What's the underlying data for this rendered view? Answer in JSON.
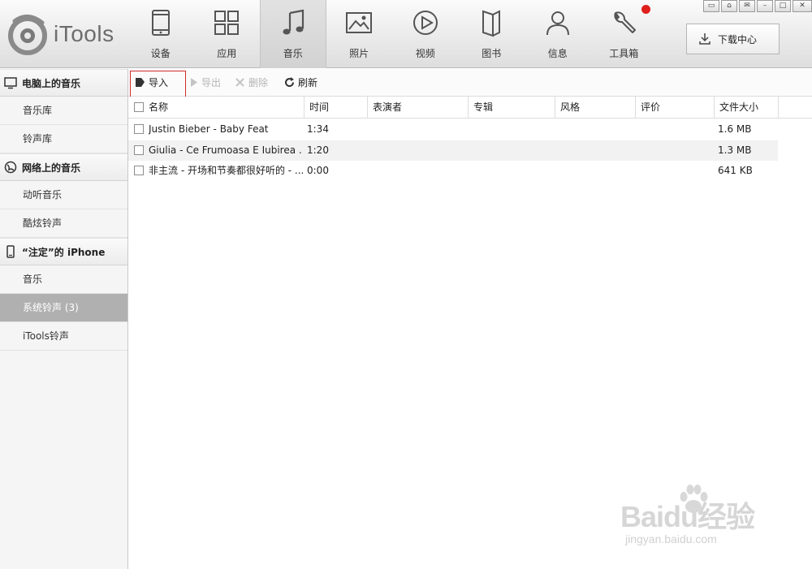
{
  "app": {
    "title": "iTools"
  },
  "nav": [
    {
      "label": "设备",
      "icon": "device-icon"
    },
    {
      "label": "应用",
      "icon": "apps-icon"
    },
    {
      "label": "音乐",
      "icon": "music-icon",
      "active": true
    },
    {
      "label": "照片",
      "icon": "photo-icon"
    },
    {
      "label": "视频",
      "icon": "video-icon"
    },
    {
      "label": "图书",
      "icon": "book-icon"
    },
    {
      "label": "信息",
      "icon": "user-icon"
    },
    {
      "label": "工具箱",
      "icon": "wrench-icon",
      "badge": true
    }
  ],
  "window_controls": [
    "feedback-icon",
    "skin-icon",
    "mail-icon",
    "minimize-icon",
    "maximize-icon",
    "close-icon"
  ],
  "download_center": {
    "label": "下载中心"
  },
  "sidebar": {
    "sections": [
      {
        "title": "电脑上的音乐",
        "icon": "monitor-icon",
        "items": [
          "音乐库",
          "铃声库"
        ]
      },
      {
        "title": "网络上的音乐",
        "icon": "globe-icon",
        "items": [
          "动听音乐",
          "酷炫铃声"
        ]
      },
      {
        "title": "“注定”的 iPhone",
        "icon": "phone-icon",
        "items": [
          "音乐",
          "系统铃声 (3)",
          "iTools铃声"
        ]
      }
    ],
    "selected": "系统铃声 (3)"
  },
  "toolbar": {
    "import": "导入",
    "export": "导出",
    "delete": "删除",
    "refresh": "刷新"
  },
  "table": {
    "columns": [
      "名称",
      "时间",
      "表演者",
      "专辑",
      "风格",
      "评价",
      "文件大小"
    ],
    "rows": [
      {
        "name": "Justin Bieber - Baby Feat",
        "time": "1:34",
        "artist": "",
        "album": "",
        "genre": "",
        "rating": "",
        "size": "1.6 MB"
      },
      {
        "name": "Giulia - Ce Frumoasa E Iubirea ...",
        "time": "1:20",
        "artist": "",
        "album": "",
        "genre": "",
        "rating": "",
        "size": "1.3 MB"
      },
      {
        "name": "非主流 - 开场和节奏都很好听的 - ...",
        "time": "0:00",
        "artist": "",
        "album": "",
        "genre": "",
        "rating": "",
        "size": "641 KB"
      }
    ]
  },
  "watermark": {
    "main": "Baidu经验",
    "sub": "jingyan.baidu.com"
  },
  "colors": {
    "accent_red": "#d12a2a",
    "badge": "#e0201c",
    "selected_item": "#b0b0b0"
  }
}
